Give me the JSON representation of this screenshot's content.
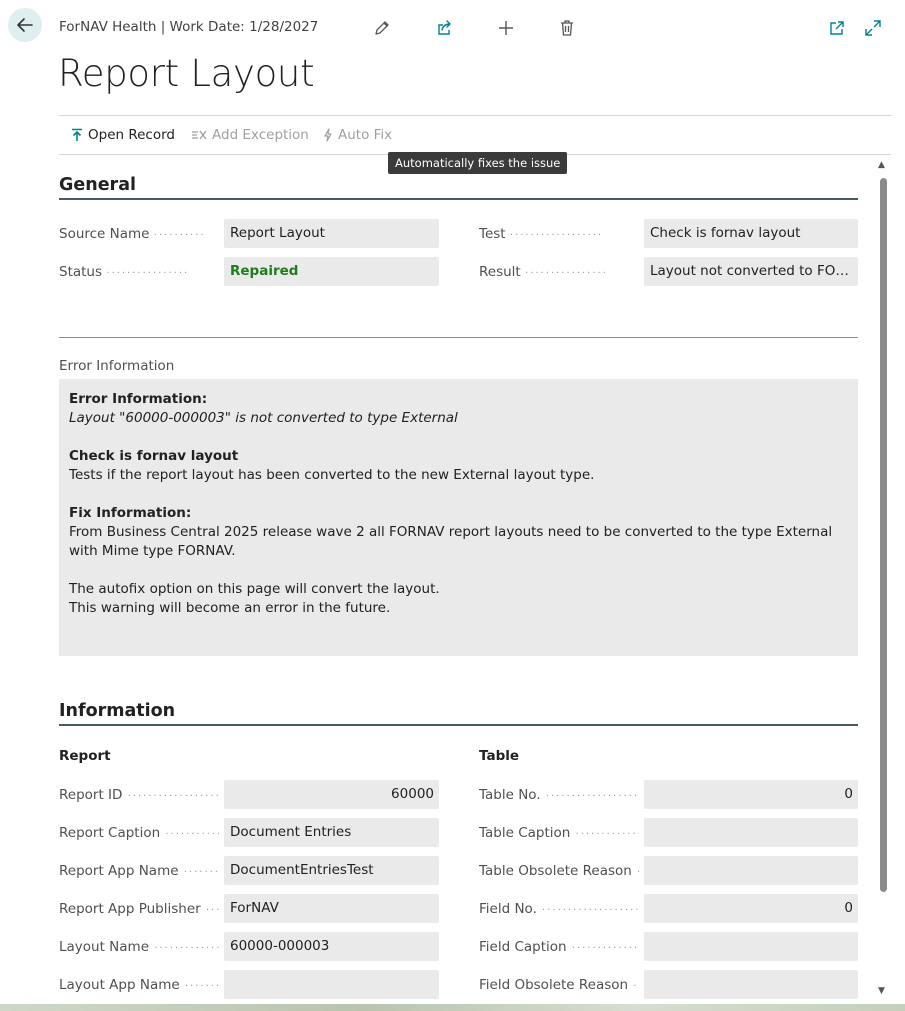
{
  "header": {
    "breadcrumb": "ForNAV Health | Work Date: 1/28/2027",
    "page_title": "Report Layout"
  },
  "icons": {
    "back": "back-arrow-icon",
    "edit": "pencil-icon",
    "share": "share-icon",
    "new": "plus-icon",
    "delete": "trash-icon",
    "open_new_window": "open-in-new-window-icon",
    "expand": "expand-icon"
  },
  "actions": {
    "open_record": "Open Record",
    "add_exception": "Add Exception",
    "auto_fix": "Auto Fix",
    "auto_fix_tooltip": "Automatically fixes the issue"
  },
  "general": {
    "title": "General",
    "source_name_label": "Source Name",
    "source_name_value": "Report Layout",
    "status_label": "Status",
    "status_value": "Repaired",
    "test_label": "Test",
    "test_value": "Check is fornav layout",
    "result_label": "Result",
    "result_value": "Layout not converted to FORN..."
  },
  "error_info": {
    "caption": "Error Information",
    "heading": "Error Information:",
    "detail": "Layout \"60000-000003\" is not converted to type External",
    "check_heading": "Check is fornav layout",
    "check_text": "Tests if the report layout has been converted to the new External layout type.",
    "fix_heading": "Fix Information:",
    "fix_text": "From Business Central 2025 release wave 2 all FORNAV report layouts need to be converted to the type External with Mime type FORNAV.",
    "autofix_line": "The autofix option on this page will convert the layout.",
    "warning_line": "This warning will become an error in the future."
  },
  "information": {
    "title": "Information",
    "report_heading": "Report",
    "table_heading": "Table",
    "report_fields": [
      {
        "label": "Report ID",
        "value": "60000"
      },
      {
        "label": "Report Caption",
        "value": "Document Entries"
      },
      {
        "label": "Report App Name",
        "value": "DocumentEntriesTest"
      },
      {
        "label": "Report App Publisher",
        "value": "ForNAV"
      },
      {
        "label": "Layout Name",
        "value": "60000-000003"
      },
      {
        "label": "Layout App Name",
        "value": ""
      }
    ],
    "table_fields": [
      {
        "label": "Table No.",
        "value": "0"
      },
      {
        "label": "Table Caption",
        "value": ""
      },
      {
        "label": "Table Obsolete Reason",
        "value": ""
      },
      {
        "label": "Field No.",
        "value": "0"
      },
      {
        "label": "Field Caption",
        "value": ""
      },
      {
        "label": "Field Obsolete Reason",
        "value": ""
      }
    ]
  },
  "colors": {
    "accent": "#00838f",
    "status_repaired": "#1e7b1e",
    "field_bg": "#eaeaea"
  }
}
